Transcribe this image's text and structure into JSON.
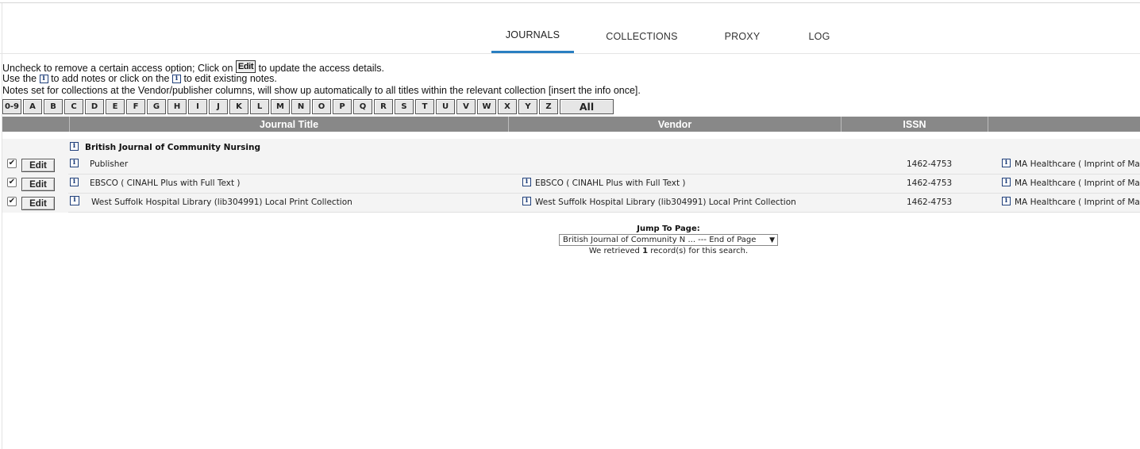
{
  "tabs": [
    {
      "label": "JOURNALS",
      "active": true
    },
    {
      "label": "COLLECTIONS",
      "active": false
    },
    {
      "label": "PROXY",
      "active": false
    },
    {
      "label": "LOG",
      "active": false
    }
  ],
  "instructions": {
    "line1_pre": "Uncheck to remove a certain access option; Click on",
    "line1_chip": "Edit",
    "line1_post": "to update the access details.",
    "line2_pre": "Use the",
    "line2_mid": "to add notes or click on the",
    "line2_post": "to edit existing notes.",
    "line3": "Notes set for collections at the Vendor/publisher columns, will show up automatically to all titles within the relevant collection [insert the info once]."
  },
  "alphabet": [
    "0-9",
    "A",
    "B",
    "C",
    "D",
    "E",
    "F",
    "G",
    "H",
    "I",
    "J",
    "K",
    "L",
    "M",
    "N",
    "O",
    "P",
    "Q",
    "R",
    "S",
    "T",
    "U",
    "V",
    "W",
    "X",
    "Y",
    "Z",
    "All"
  ],
  "table": {
    "headers": [
      "",
      "Journal Title",
      "Vendor",
      "ISSN",
      ""
    ],
    "group_title": "British Journal of Community Nursing",
    "edit_label": "Edit",
    "info_glyph": "i",
    "rows": [
      {
        "checked": true,
        "title": "Publisher",
        "vendor": "",
        "issn": "1462-4753",
        "publisher": "MA Healthcare ( Imprint of Mar"
      },
      {
        "checked": true,
        "title": "EBSCO ( CINAHL Plus with Full Text )",
        "vendor": "EBSCO ( CINAHL Plus with Full Text )",
        "issn": "1462-4753",
        "publisher": "MA Healthcare ( Imprint of Mar"
      },
      {
        "checked": true,
        "title": "West Suffolk Hospital Library (lib304991) Local Print Collection",
        "vendor": "West Suffolk Hospital Library (lib304991) Local Print Collection",
        "issn": "1462-4753",
        "publisher": "MA Healthcare ( Imprint of Mar"
      }
    ]
  },
  "footer": {
    "jump_label": "Jump To Page:",
    "jump_value": "British Journal of Community N ... --- End of Page",
    "retrieved_pre": "We retrieved",
    "retrieved_count": "1",
    "retrieved_post": "record(s) for this search."
  },
  "icons": {
    "checkbox": "check-icon",
    "info": "info-icon",
    "dropdown": "caret-down-icon"
  },
  "colors": {
    "tab_accent": "#2a7fc1",
    "header_bg": "#888888",
    "info_icon": "#1f3f7a"
  }
}
